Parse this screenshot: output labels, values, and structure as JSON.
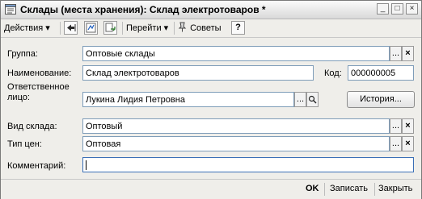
{
  "window": {
    "title": "Склады (места хранения): Склад электротоваров *",
    "min_glyph": "_",
    "max_glyph": "□",
    "close_glyph": "×"
  },
  "toolbar": {
    "actions_label": "Действия",
    "dropdown_glyph": "▾",
    "goto_label": "Перейти",
    "tips_label": "Советы",
    "help_label": "?"
  },
  "form": {
    "group_label": "Группа:",
    "group_value": "Оптовые склады",
    "name_label": "Наименование:",
    "name_value": "Склад электротоваров",
    "code_label": "Код:",
    "code_value": "000000005",
    "responsible_label_line1": "Ответственное",
    "responsible_label_line2": "лицо:",
    "responsible_value": "Лукина  Лидия Петровна",
    "history_button": "История...",
    "warehouse_type_label": "Вид склада:",
    "warehouse_type_value": "Оптовый",
    "price_type_label": "Тип цен:",
    "price_type_value": "Оптовая",
    "comment_label": "Комментарий:",
    "comment_value": "",
    "select_glyph": "...",
    "clear_glyph": "×"
  },
  "footer": {
    "ok_label": "OK",
    "save_label": "Записать",
    "close_label": "Закрыть"
  }
}
